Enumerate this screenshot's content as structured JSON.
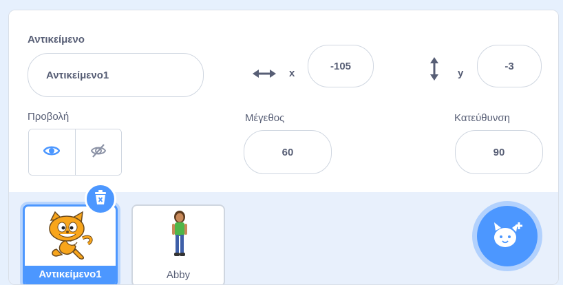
{
  "sprite_info": {
    "sprite_label": "Αντικείμενο",
    "sprite_name_value": "Αντικείμενο1",
    "x_label": "x",
    "x_value": "-105",
    "y_label": "y",
    "y_value": "-3",
    "show_label": "Προβολή",
    "size_label": "Μέγεθος",
    "size_value": "60",
    "direction_label": "Κατεύθυνση",
    "direction_value": "90"
  },
  "sprites": [
    {
      "name": "Αντικείμενο1",
      "selected": true
    },
    {
      "name": "Abby",
      "selected": false
    }
  ],
  "colors": {
    "accent": "#4c97ff",
    "text": "#575e75",
    "border": "#cfd6e0",
    "sprite_area_bg": "#e8f0fc"
  },
  "icons": {
    "x_axis": "horizontal-arrows-icon",
    "y_axis": "vertical-arrows-icon",
    "show": "eye-icon",
    "hide": "eye-slash-icon",
    "delete": "trash-icon",
    "add_sprite": "cat-plus-icon"
  }
}
